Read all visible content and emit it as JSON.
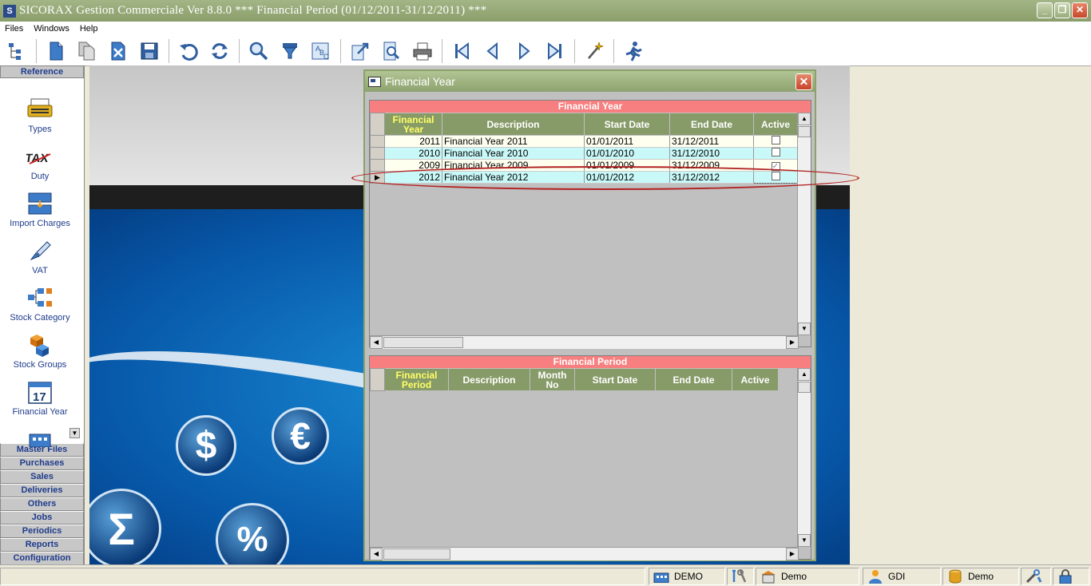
{
  "window": {
    "app_icon": "S",
    "title": "SICORAX Gestion Commerciale Ver 8.8.0   ***   Financial Period (01/12/2011-31/12/2011)   ***",
    "buttons": [
      "minimize",
      "restore",
      "close"
    ]
  },
  "menu": [
    "Files",
    "Windows",
    "Help"
  ],
  "toolbar": {
    "icons": [
      "tree-icon",
      "new-document-icon",
      "copy-document-icon",
      "delete-icon",
      "save-icon",
      "undo-icon",
      "refresh-icon",
      "search-icon",
      "filter-icon",
      "sort-icon",
      "export-icon",
      "preview-icon",
      "print-icon",
      "first-record-icon",
      "previous-record-icon",
      "next-record-icon",
      "last-record-icon",
      "wizard-icon",
      "exit-icon"
    ]
  },
  "left_panel": {
    "header": "Reference",
    "items": [
      {
        "label": "Types",
        "icon": "typewriter-icon"
      },
      {
        "label": "Duty",
        "icon": "tax-icon"
      },
      {
        "label": "Import Charges",
        "icon": "import-charges-icon"
      },
      {
        "label": "VAT",
        "icon": "stamp-icon"
      },
      {
        "label": "Stock Category",
        "icon": "hierarchy-icon"
      },
      {
        "label": "Stock Groups",
        "icon": "cubes-icon"
      },
      {
        "label": "Financial Year",
        "icon": "calendar-icon",
        "calendar_number": "17"
      }
    ],
    "sections": [
      "Master Files",
      "Purchases",
      "Sales",
      "Deliveries",
      "Others",
      "Jobs",
      "Periodics",
      "Reports",
      "Configuration"
    ]
  },
  "background": {
    "symbols": [
      "$",
      "€",
      "Σ",
      "%"
    ]
  },
  "dialog": {
    "title": "Financial Year",
    "year_grid": {
      "caption": "Financial Year",
      "columns": [
        "Financial Year",
        "Description",
        "Start Date",
        "End Date",
        "Active"
      ],
      "rows": [
        {
          "year": "2011",
          "description": "Financial Year 2011",
          "start": "01/01/2011",
          "end": "31/12/2011",
          "active": false
        },
        {
          "year": "2010",
          "description": "Financial Year 2010",
          "start": "01/01/2010",
          "end": "31/12/2010",
          "active": false
        },
        {
          "year": "2009",
          "description": "Financial Year 2009",
          "start": "01/01/2009",
          "end": "31/12/2009",
          "active": true
        },
        {
          "year": "2012",
          "description": "Financial Year 2012",
          "start": "01/01/2012",
          "end": "31/12/2012",
          "active": false,
          "current": true
        }
      ]
    },
    "period_grid": {
      "caption": "Financial Period",
      "columns": [
        "Financial Period",
        "Description",
        "Month No",
        "Start Date",
        "End Date",
        "Active"
      ]
    }
  },
  "status_bar": {
    "segments": [
      {
        "icon": "company-icon",
        "text": "DEMO"
      },
      {
        "icon": "tools-icon",
        "text": ""
      },
      {
        "icon": "store-icon",
        "text": "Demo"
      },
      {
        "icon": "user-icon",
        "text": "GDI"
      },
      {
        "icon": "database-icon",
        "text": "Demo"
      },
      {
        "icon": "settings-icon",
        "text": ""
      },
      {
        "icon": "lock-icon",
        "text": ""
      }
    ]
  },
  "colors": {
    "title_bar": "#8a9e6b",
    "grid_caption": "#f77f7f",
    "grid_header": "#879b68",
    "row_alt": "#c8f8f8",
    "nav_text": "#1f3c8c",
    "highlight_ring": "#b02020"
  }
}
